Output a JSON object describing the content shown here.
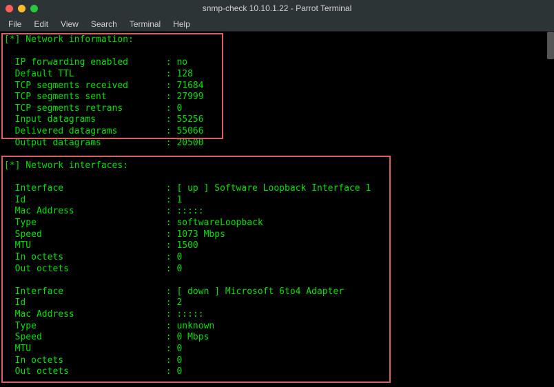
{
  "window": {
    "title": "snmp-check 10.10.1.22 - Parrot Terminal"
  },
  "menu": {
    "file": "File",
    "edit": "Edit",
    "view": "View",
    "search": "Search",
    "terminal": "Terminal",
    "help": "Help"
  },
  "sections": {
    "net_info_header": "[*] Network information:",
    "net_ifaces_header": "[*] Network interfaces:"
  },
  "net_info": [
    {
      "label": "IP forwarding enabled",
      "value": "no"
    },
    {
      "label": "Default TTL",
      "value": "128"
    },
    {
      "label": "TCP segments received",
      "value": "71684"
    },
    {
      "label": "TCP segments sent",
      "value": "27999"
    },
    {
      "label": "TCP segments retrans",
      "value": "0"
    },
    {
      "label": "Input datagrams",
      "value": "55256"
    },
    {
      "label": "Delivered datagrams",
      "value": "55066"
    },
    {
      "label": "Output datagrams",
      "value": "20500"
    }
  ],
  "interfaces": [
    {
      "rows": [
        {
          "label": "Interface",
          "value": "[ up ] Software Loopback Interface 1"
        },
        {
          "label": "Id",
          "value": "1"
        },
        {
          "label": "Mac Address",
          "value": ":::::"
        },
        {
          "label": "Type",
          "value": "softwareLoopback"
        },
        {
          "label": "Speed",
          "value": "1073 Mbps"
        },
        {
          "label": "MTU",
          "value": "1500"
        },
        {
          "label": "In octets",
          "value": "0"
        },
        {
          "label": "Out octets",
          "value": "0"
        }
      ]
    },
    {
      "rows": [
        {
          "label": "Interface",
          "value": "[ down ] Microsoft 6to4 Adapter"
        },
        {
          "label": "Id",
          "value": "2"
        },
        {
          "label": "Mac Address",
          "value": ":::::"
        },
        {
          "label": "Type",
          "value": "unknown"
        },
        {
          "label": "Speed",
          "value": "0 Mbps"
        },
        {
          "label": "MTU",
          "value": "0"
        },
        {
          "label": "In octets",
          "value": "0"
        },
        {
          "label": "Out octets",
          "value": "0"
        }
      ]
    }
  ]
}
